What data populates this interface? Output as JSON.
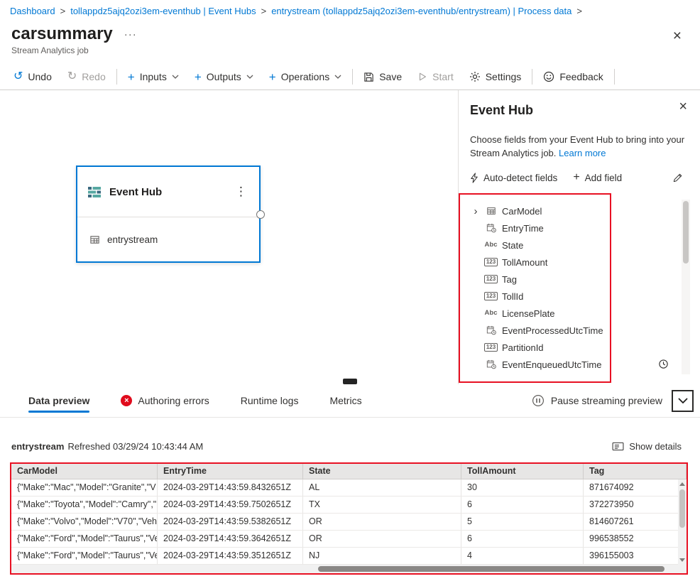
{
  "colors": {
    "accent": "#0078d4",
    "highlight": "#e81123",
    "error": "#e00b1c",
    "text": "#323130",
    "text2": "#605e5c",
    "border": "#e1dfdd",
    "disabled": "#a19f9d"
  },
  "glyphs": {
    "more": "···",
    "close": "×",
    "dots_menu": "⋮",
    "breadcrumb_sep": ">",
    "expander": "›",
    "number_badge": "123",
    "string_badge": "Abc",
    "plus": "+",
    "undo": "↺",
    "redo": "↻",
    "error_x": "×"
  },
  "breadcrumb": {
    "items": [
      "Dashboard",
      "tollappdz5ajq2ozi3em-eventhub | Event Hubs",
      "entrystream (tollappdz5ajq2ozi3em-eventhub/entrystream) | Process data"
    ]
  },
  "header": {
    "title": "carsummary",
    "subtitle": "Stream Analytics job"
  },
  "toolbar": {
    "undo": "Undo",
    "redo": "Redo",
    "inputs": "Inputs",
    "outputs": "Outputs",
    "operations": "Operations",
    "save": "Save",
    "start": "Start",
    "settings": "Settings",
    "feedback": "Feedback"
  },
  "canvas": {
    "node": {
      "title": "Event Hub",
      "input": "entrystream"
    }
  },
  "panel": {
    "title": "Event Hub",
    "description": "Choose fields from your Event Hub to bring into your Stream Analytics job.",
    "learn_more": "Learn more",
    "auto_detect": "Auto-detect fields",
    "add_field": "Add field",
    "fields": [
      {
        "name": "CarModel",
        "type": "record"
      },
      {
        "name": "EntryTime",
        "type": "datetime"
      },
      {
        "name": "State",
        "type": "string"
      },
      {
        "name": "TollAmount",
        "type": "number"
      },
      {
        "name": "Tag",
        "type": "number"
      },
      {
        "name": "TollId",
        "type": "number"
      },
      {
        "name": "LicensePlate",
        "type": "string"
      },
      {
        "name": "EventProcessedUtcTime",
        "type": "datetime"
      },
      {
        "name": "PartitionId",
        "type": "number"
      },
      {
        "name": "EventEnqueuedUtcTime",
        "type": "datetime"
      }
    ]
  },
  "tabs": {
    "data_preview": "Data preview",
    "authoring_errors": "Authoring errors",
    "runtime_logs": "Runtime logs",
    "metrics": "Metrics",
    "pause": "Pause streaming preview"
  },
  "preview": {
    "source": "entrystream",
    "refreshed": "Refreshed 03/29/24 10:43:44 AM",
    "show_details": "Show details",
    "table": {
      "columns": [
        "CarModel",
        "EntryTime",
        "State",
        "TollAmount",
        "Tag"
      ],
      "rows": [
        [
          "{\"Make\":\"Mac\",\"Model\":\"Granite\",\"V",
          "2024-03-29T14:43:59.8432651Z",
          "AL",
          "30",
          "871674092"
        ],
        [
          "{\"Make\":\"Toyota\",\"Model\":\"Camry\",\"",
          "2024-03-29T14:43:59.7502651Z",
          "TX",
          "6",
          "372273950"
        ],
        [
          "{\"Make\":\"Volvo\",\"Model\":\"V70\",\"Veh",
          "2024-03-29T14:43:59.5382651Z",
          "OR",
          "5",
          "814607261"
        ],
        [
          "{\"Make\":\"Ford\",\"Model\":\"Taurus\",\"Ve",
          "2024-03-29T14:43:59.3642651Z",
          "OR",
          "6",
          "996538552"
        ],
        [
          "{\"Make\":\"Ford\",\"Model\":\"Taurus\",\"Ve",
          "2024-03-29T14:43:59.3512651Z",
          "NJ",
          "4",
          "396155003"
        ]
      ]
    }
  }
}
